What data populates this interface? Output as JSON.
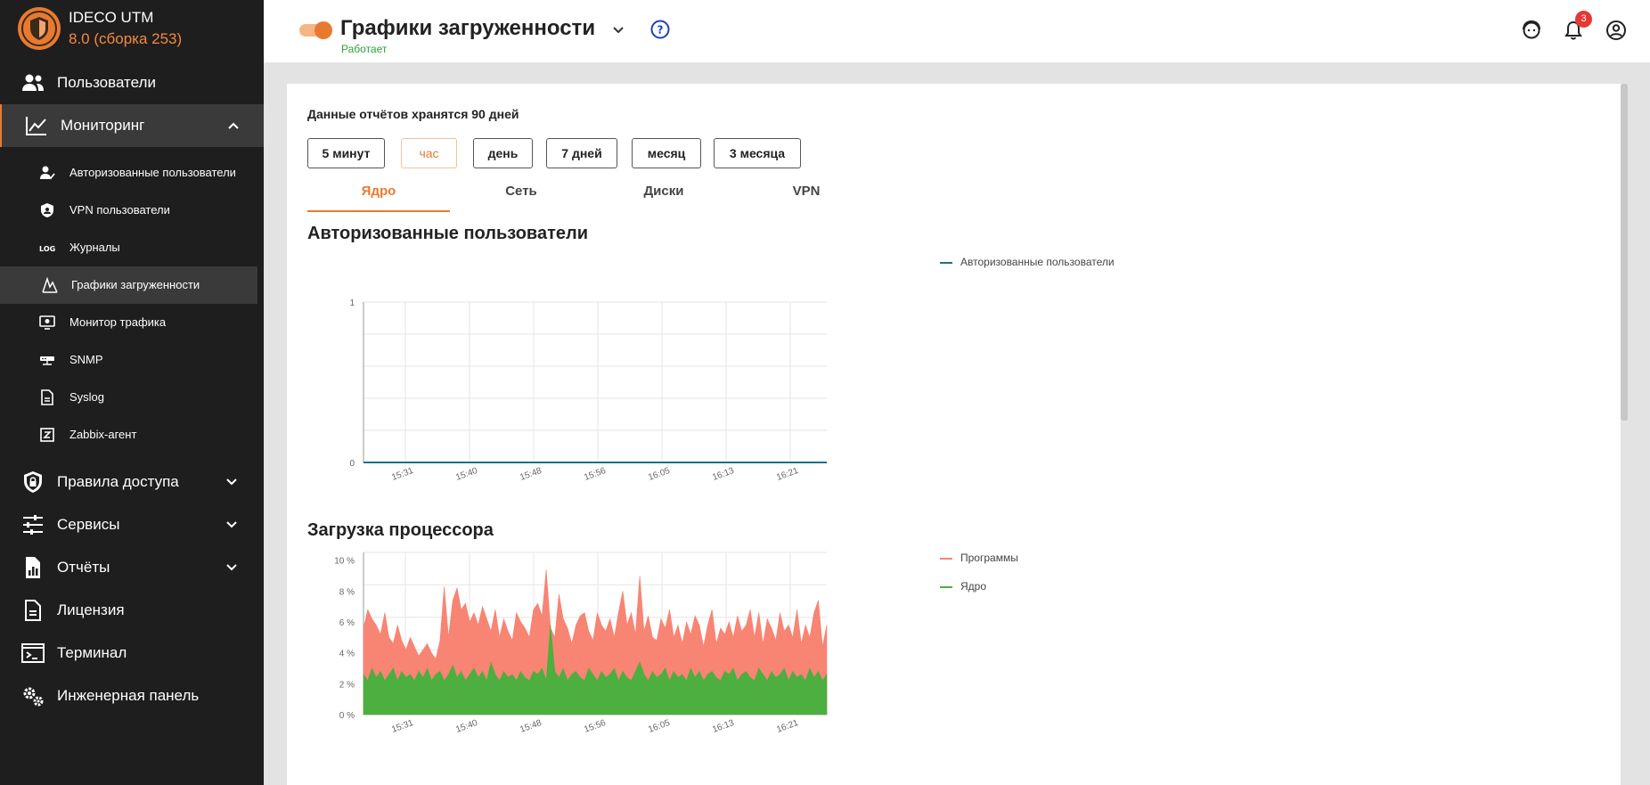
{
  "brand": {
    "name": "IDECO UTM",
    "version": "8.0 (сборка 253)"
  },
  "sidebar": {
    "items": [
      {
        "label": "Пользователи",
        "icon": "users-icon"
      },
      {
        "label": "Мониторинг",
        "icon": "monitoring-icon",
        "expanded": true
      },
      {
        "label": "Правила доступа",
        "icon": "shield-lock-icon"
      },
      {
        "label": "Сервисы",
        "icon": "sliders-icon"
      },
      {
        "label": "Отчёты",
        "icon": "report-icon"
      },
      {
        "label": "Лицензия",
        "icon": "license-icon"
      },
      {
        "label": "Терминал",
        "icon": "terminal-icon"
      },
      {
        "label": "Инженерная панель",
        "icon": "gears-icon"
      }
    ],
    "subitems": [
      {
        "label": "Авторизованные пользователи",
        "icon": "user-check-icon"
      },
      {
        "label": "VPN пользователи",
        "icon": "vpn-shield-icon"
      },
      {
        "label": "Журналы",
        "icon": "log-icon"
      },
      {
        "label": "Графики загруженности",
        "icon": "chart-icon",
        "active": true
      },
      {
        "label": "Монитор трафика",
        "icon": "traffic-monitor-icon"
      },
      {
        "label": "SNMP",
        "icon": "snmp-icon"
      },
      {
        "label": "Syslog",
        "icon": "syslog-icon"
      },
      {
        "label": "Zabbix-агент",
        "icon": "zabbix-icon"
      }
    ]
  },
  "header": {
    "title": "Графики загруженности",
    "status": "Работает",
    "notifications_count": "3"
  },
  "content": {
    "retention_note": "Данные отчётов хранятся 90 дней",
    "periods": [
      "5 минут",
      "час",
      "день",
      "7 дней",
      "месяц",
      "3 месяца"
    ],
    "active_period": "час",
    "tabs": [
      "Ядро",
      "Сеть",
      "Диски",
      "VPN"
    ],
    "active_tab": "Ядро"
  },
  "colors": {
    "accent": "#e87a30",
    "status_green": "#2e9e3a",
    "series_users": "#1f6f8b",
    "series_programs": "#f88473",
    "series_kernel": "#4caf3f"
  },
  "chart_data": [
    {
      "type": "line",
      "title": "Авторизованные пользователи",
      "x_ticks": [
        "15:31",
        "15:40",
        "15:48",
        "15:56",
        "16:05",
        "16:13",
        "16:21"
      ],
      "y_ticks": [
        "1",
        "0"
      ],
      "ylim": [
        0,
        1
      ],
      "grid": true,
      "legend": "right",
      "series": [
        {
          "name": "Авторизованные пользователи",
          "values": [
            0,
            0,
            0,
            0,
            0,
            0,
            0,
            0
          ]
        }
      ]
    },
    {
      "type": "area",
      "title": "Загрузка процессора",
      "x_ticks": [
        "15:31",
        "15:40",
        "15:48",
        "15:56",
        "16:05",
        "16:13",
        "16:21"
      ],
      "y_ticks": [
        "10 %",
        "8 %",
        "6 %",
        "4 %",
        "2 %",
        "0 %"
      ],
      "ylim": [
        0,
        10.5
      ],
      "grid": true,
      "legend": "right",
      "series": [
        {
          "name": "Программы",
          "values": [
            5.6,
            6.8,
            6.2,
            5.8,
            5.2,
            6.6,
            5.0,
            4.6,
            5.8,
            4.8,
            4.2,
            5.0,
            4.4,
            3.8,
            4.2,
            4.6,
            4.0,
            3.6,
            4.8,
            8.3,
            5.0,
            7.4,
            8.2,
            6.8,
            7.2,
            6.0,
            6.6,
            5.8,
            7.0,
            6.2,
            5.4,
            6.8,
            5.0,
            6.2,
            5.4,
            4.8,
            6.6,
            6.0,
            5.6,
            5.0,
            6.8,
            7.2,
            6.4,
            9.4,
            5.6,
            5.0,
            7.8,
            6.2,
            5.6,
            4.6,
            5.8,
            6.4,
            6.6,
            5.4,
            4.8,
            6.6,
            5.8,
            5.4,
            6.2,
            5.0,
            6.6,
            8.0,
            5.8,
            6.6,
            5.2,
            9.0,
            5.4,
            6.4,
            5.0,
            4.8,
            6.2,
            5.6,
            6.8,
            5.0,
            5.8,
            4.6,
            6.0,
            5.2,
            6.4,
            5.8,
            4.4,
            5.8,
            6.8,
            4.6,
            5.6,
            5.2,
            6.0,
            5.0,
            6.4,
            5.4,
            5.8,
            6.8,
            5.0,
            6.6,
            4.6,
            6.2,
            5.6,
            4.8,
            6.6,
            5.4,
            5.8,
            5.0,
            6.8,
            4.6,
            5.8,
            5.0,
            6.6,
            7.4,
            4.4,
            5.8
          ]
        },
        {
          "name": "Ядро",
          "values": [
            2.6,
            2.2,
            3.0,
            2.4,
            2.8,
            2.2,
            2.6,
            3.0,
            2.2,
            2.8,
            2.4,
            2.6,
            2.2,
            2.8,
            2.4,
            3.0,
            2.2,
            2.6,
            2.8,
            2.2,
            2.6,
            3.2,
            2.4,
            2.8,
            2.2,
            2.6,
            3.0,
            2.4,
            2.8,
            2.2,
            3.4,
            2.6,
            2.2,
            2.8,
            2.4,
            2.6,
            2.2,
            2.8,
            2.4,
            2.2,
            2.8,
            2.6,
            3.0,
            2.2,
            5.8,
            2.8,
            2.4,
            3.0,
            2.2,
            2.6,
            2.8,
            2.4,
            2.2,
            3.0,
            2.6,
            2.2,
            2.8,
            2.4,
            2.6,
            3.0,
            2.2,
            2.8,
            2.4,
            2.2,
            2.8,
            3.4,
            2.6,
            2.2,
            2.8,
            2.4,
            2.6,
            3.0,
            2.2,
            2.8,
            2.4,
            2.6,
            2.2,
            3.0,
            2.4,
            2.8,
            2.2,
            2.6,
            2.8,
            2.4,
            2.2,
            2.8,
            2.6,
            3.0,
            2.2,
            2.6,
            2.8,
            2.4,
            2.2,
            3.0,
            2.6,
            2.2,
            2.8,
            2.4,
            2.6,
            3.0,
            2.2,
            2.8,
            2.4,
            2.6,
            2.2,
            3.0,
            2.4,
            2.8,
            2.2,
            2.6
          ]
        }
      ]
    }
  ]
}
